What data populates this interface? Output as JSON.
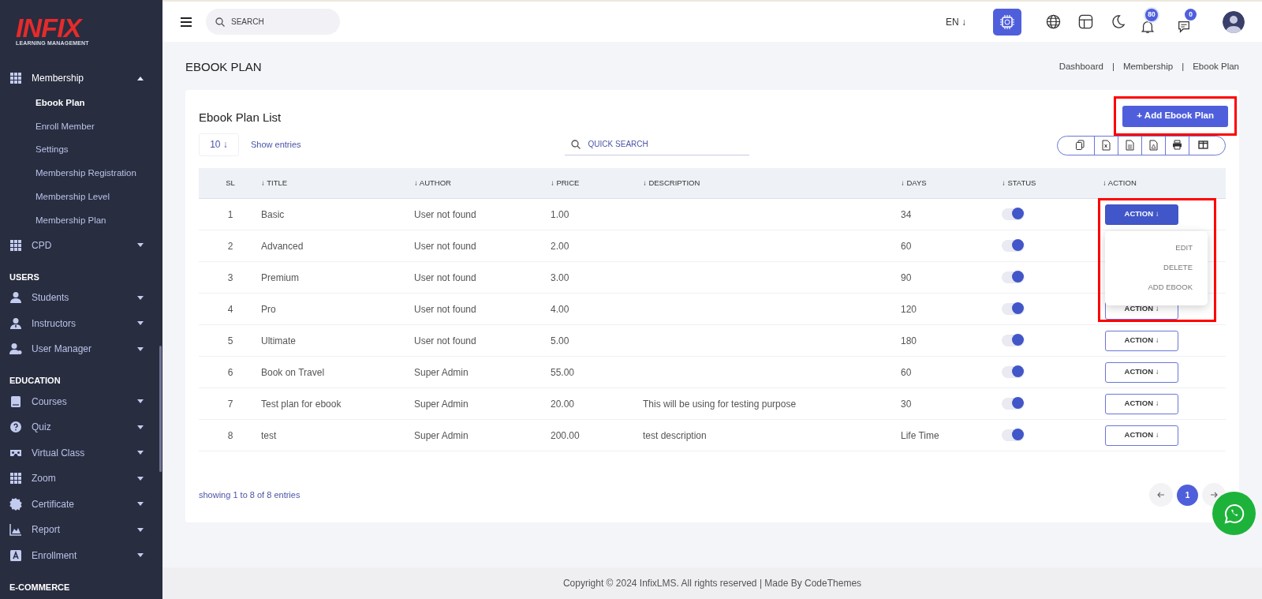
{
  "sidebar": {
    "logo": {
      "brand": "INFIX",
      "tagline": "LEARNING MANAGEMENT"
    },
    "sections": [
      {
        "items": [
          {
            "label": "Membership",
            "expanded": true,
            "children": [
              {
                "label": "Ebook Plan",
                "selected": true
              },
              {
                "label": "Enroll Member",
                "selected": false
              },
              {
                "label": "Settings",
                "selected": false
              },
              {
                "label": "Membership Registration",
                "selected": false
              },
              {
                "label": "Membership Level",
                "selected": false
              },
              {
                "label": "Membership Plan",
                "selected": false
              }
            ]
          },
          {
            "label": "CPD",
            "expanded": false
          }
        ]
      },
      {
        "heading": "USERS",
        "items": [
          {
            "label": "Students",
            "expanded": false
          },
          {
            "label": "Instructors",
            "expanded": false
          },
          {
            "label": "User Manager",
            "expanded": false
          }
        ]
      },
      {
        "heading": "EDUCATION",
        "items": [
          {
            "label": "Courses",
            "expanded": false
          },
          {
            "label": "Quiz",
            "expanded": false
          },
          {
            "label": "Virtual Class",
            "expanded": false
          },
          {
            "label": "Zoom",
            "expanded": false
          },
          {
            "label": "Certificate",
            "expanded": false
          },
          {
            "label": "Report",
            "expanded": false
          },
          {
            "label": "Enrollment",
            "expanded": false
          }
        ]
      },
      {
        "heading": "E-COMMERCE"
      }
    ]
  },
  "topbar": {
    "search": {
      "placeholder": "SEARCH"
    },
    "language": "EN ↓",
    "notifications": "80",
    "messages": "0"
  },
  "page": {
    "title": "EBOOK PLAN",
    "breadcrumb": [
      "Dashboard",
      "Membership",
      "Ebook Plan"
    ],
    "breadcrumb_separators": [
      "|",
      "|"
    ]
  },
  "card": {
    "title": "Ebook Plan List",
    "add_button": {
      "label": "+ Add Ebook Plan",
      "highlighted": true
    },
    "page_size": "10 ↓",
    "show_entries": "Show entries",
    "quick_search": {
      "placeholder": "QUICK SEARCH"
    },
    "table": {
      "columns": [
        "SL",
        "↓ TITLE",
        "↓ AUTHOR",
        "↓ PRICE",
        "↓ DESCRIPTION",
        "↓ DAYS",
        "↓ STATUS",
        "↓ ACTION"
      ],
      "action_menu": [
        "EDIT",
        "DELETE",
        "ADD EBOOK"
      ],
      "rows": [
        {
          "sl": "1",
          "title": "Basic",
          "author": "User not found",
          "price": "1.00",
          "description": "",
          "days": "34",
          "on": true,
          "action": "ACTION ↓",
          "menu_open": true,
          "highlighted": true
        },
        {
          "sl": "2",
          "title": "Advanced",
          "author": "User not found",
          "price": "2.00",
          "description": "",
          "days": "60",
          "on": true,
          "highlighted": false
        },
        {
          "sl": "3",
          "title": "Premium",
          "author": "User not found",
          "price": "3.00",
          "description": "",
          "days": "90",
          "on": true,
          "highlighted": false
        },
        {
          "sl": "4",
          "title": "Pro",
          "author": "User not found",
          "price": "4.00",
          "description": "",
          "days": "120",
          "on": true,
          "action": "ACTION ↓",
          "menu_open": false,
          "highlighted": false
        },
        {
          "sl": "5",
          "title": "Ultimate",
          "author": "User not found",
          "price": "5.00",
          "description": "",
          "days": "180",
          "on": true,
          "action": "ACTION ↓",
          "menu_open": false,
          "highlighted": false
        },
        {
          "sl": "6",
          "title": "Book on Travel",
          "author": "Super Admin",
          "price": "55.00",
          "description": "",
          "days": "60",
          "on": true,
          "action": "ACTION ↓",
          "menu_open": false,
          "highlighted": false
        },
        {
          "sl": "7",
          "title": "Test plan for ebook",
          "author": "Super Admin",
          "price": "20.00",
          "description": "This will be using for testing purpose",
          "days": "30",
          "on": true,
          "action": "ACTION ↓",
          "menu_open": false,
          "highlighted": false
        },
        {
          "sl": "8",
          "title": "test",
          "author": "Super Admin",
          "price": "200.00",
          "description": "test description",
          "days": "Life Time",
          "on": true,
          "action": "ACTION ↓",
          "menu_open": false,
          "highlighted": false
        }
      ]
    },
    "summary": "showing 1 to 8 of 8 entries",
    "pages": [
      {
        "label": "1",
        "selected": true
      }
    ]
  },
  "footer": "Copyright © 2024 InfixLMS. All rights reserved | Made By CodeThemes"
}
